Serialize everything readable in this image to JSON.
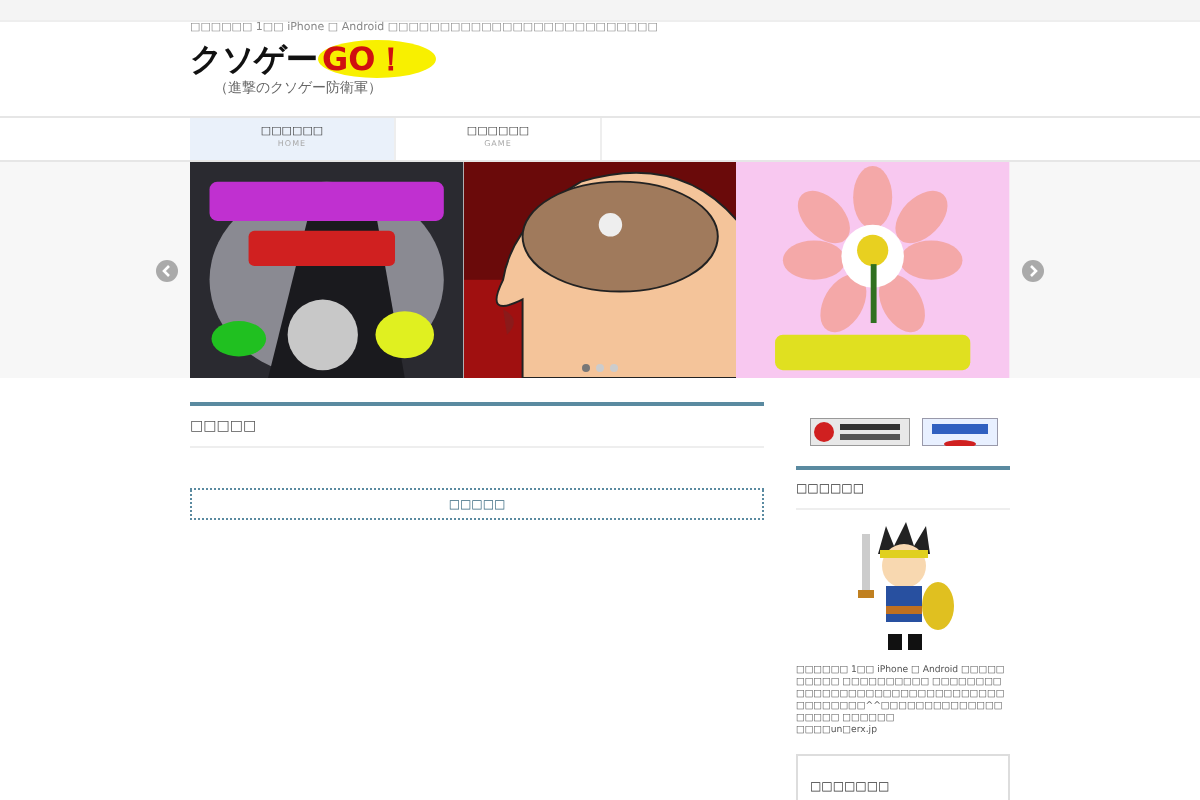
{
  "top_bar": {
    "text": "□□□□□□ 1□□ iPhone □ Android □□□□□□□□□□□□□□□□□□□□□□□□□□"
  },
  "header": {
    "logo_main": "クソゲー",
    "logo_accent": "GO！",
    "subtitle": "（進撃のクソゲー防衛軍）"
  },
  "nav": [
    {
      "label": "□□□□□□",
      "sub": "HOME",
      "selected": true
    },
    {
      "label": "□□□□□□",
      "sub": "GAME",
      "selected": false
    }
  ],
  "slider": {
    "dots": [
      {
        "selected": true
      },
      {
        "selected": false
      },
      {
        "selected": false
      }
    ]
  },
  "main": {
    "heading": "□□□□□",
    "button": "□□□□□"
  },
  "sidebar": {
    "widgets": [
      {
        "kind": "profile",
        "title": "□□□□□□",
        "text": "□□□□□□ 1□□ iPhone □ Android □□□□□□□□□□ □□□□□□□□□□ □□□□□□□□□□□□□□□□□□□□□□□□□□□□□□□□□□□□□□□□^^□□□□□□□□□□□□□□□□□□□ □□□□□□",
        "contact": "□□□□un□erx.jp"
      },
      {
        "kind": "list",
        "title": "□□□□□□□"
      }
    ]
  }
}
